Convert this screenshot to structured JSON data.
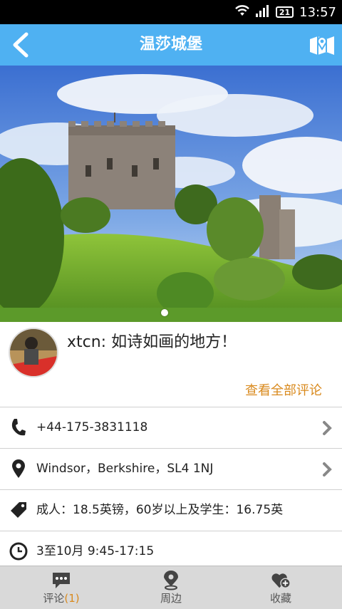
{
  "status": {
    "time": "13:57",
    "battery": "21"
  },
  "header": {
    "title": "温莎城堡"
  },
  "review": {
    "text": "xtcn: 如诗如画的地方！",
    "all_link": "查看全部评论"
  },
  "details": {
    "phone": "+44-175-3831118",
    "address": "Windsor，Berkshire，SL4 1NJ",
    "price": "成人：18.5英镑，60岁以上及学生：16.75英",
    "hours": "3至10月 9:45-17:15"
  },
  "tabs": [
    {
      "label": "评论",
      "count": "(1)"
    },
    {
      "label": "周边"
    },
    {
      "label": "收藏"
    }
  ],
  "colors": {
    "accent": "#4fb1f2",
    "highlight": "#d98a1e"
  }
}
